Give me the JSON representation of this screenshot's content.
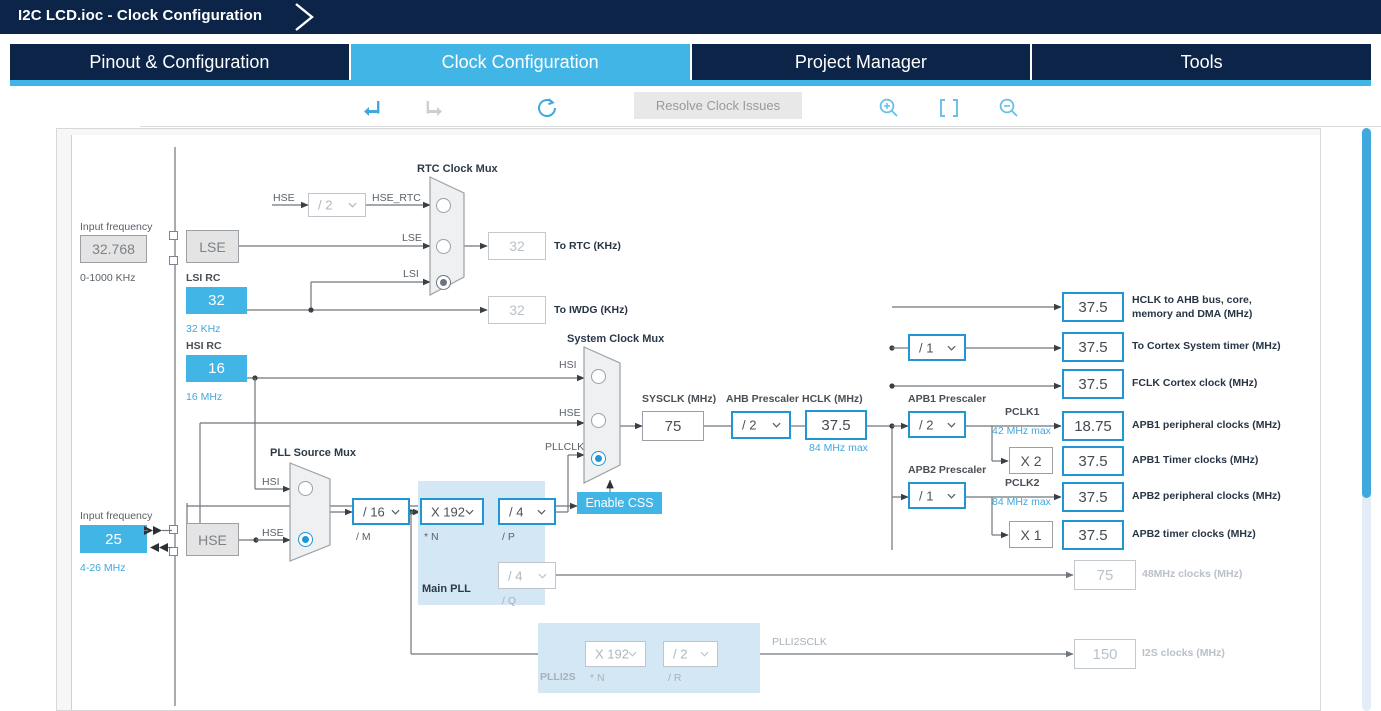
{
  "window": {
    "title": "I2C LCD.ioc - Clock Configuration"
  },
  "tabs": [
    {
      "label": "Pinout & Configuration",
      "active": false
    },
    {
      "label": "Clock Configuration",
      "active": true
    },
    {
      "label": "Project Manager",
      "active": false
    },
    {
      "label": "Tools",
      "active": false
    }
  ],
  "toolbar": {
    "undo": "undo-icon",
    "redo": "redo-icon",
    "reset": "reset-icon",
    "resolve_label": "Resolve Clock Issues",
    "zoom_in": "zoom-in-icon",
    "fit": "fit-to-screen-icon",
    "zoom_out": "zoom-out-icon"
  },
  "diagram": {
    "lse": {
      "input_frequency_label": "Input frequency",
      "input_frequency_value": "32.768",
      "range": "0-1000 KHz",
      "osc_label": "LSE"
    },
    "lsi": {
      "title": "LSI RC",
      "value": "32",
      "range": "32 KHz"
    },
    "hsi": {
      "title": "HSI RC",
      "value": "16",
      "range": "16 MHz"
    },
    "hse": {
      "input_frequency_label": "Input frequency",
      "input_frequency_value": "25",
      "range": "4-26 MHz",
      "osc_label": "HSE"
    },
    "hse_rtc_divider": {
      "value": "/ 2",
      "in_label": "HSE",
      "out_label": "HSE_RTC"
    },
    "rtc_mux": {
      "title": "RTC Clock Mux",
      "inputs": [
        "HSE_RTC",
        "LSE",
        "LSI"
      ],
      "selected_index": 2
    },
    "to_rtc": {
      "value": "32",
      "label": "To RTC (KHz)"
    },
    "to_iwdg": {
      "value": "32",
      "label": "To IWDG (KHz)"
    },
    "pll_source_mux": {
      "title": "PLL Source Mux",
      "inputs": [
        "HSI",
        "HSE"
      ],
      "selected_index": 1
    },
    "pll_m": {
      "value": "/ 16",
      "label": "/ M"
    },
    "main_pll": {
      "title": "Main PLL",
      "n": {
        "value": "X 192",
        "label": "* N"
      },
      "p": {
        "value": "/ 4",
        "label": "/ P"
      },
      "q": {
        "value": "/ 4",
        "label": "/ Q"
      }
    },
    "system_clock_mux": {
      "title": "System Clock Mux",
      "inputs": [
        "HSI",
        "HSE",
        "PLLCLK"
      ],
      "selected_index": 2
    },
    "enable_css": {
      "label": "Enable CSS"
    },
    "sysclk": {
      "title": "SYSCLK (MHz)",
      "value": "75"
    },
    "ahb_prescaler": {
      "title": "AHB Prescaler",
      "value": "/ 2"
    },
    "hclk": {
      "title": "HCLK (MHz)",
      "value": "37.5",
      "max": "84 MHz max"
    },
    "cortex_divider": {
      "value": "/ 1"
    },
    "outputs": [
      {
        "value": "37.5",
        "label": "HCLK to AHB bus, core,",
        "label2": "memory and DMA (MHz)"
      },
      {
        "value": "37.5",
        "label": "To Cortex System timer (MHz)"
      },
      {
        "value": "37.5",
        "label": "FCLK Cortex clock (MHz)"
      }
    ],
    "apb1": {
      "prescaler_title": "APB1 Prescaler",
      "prescaler_value": "/ 2",
      "pclk_label": "PCLK1",
      "pclk_max": "42 MHz max",
      "peripheral_value": "18.75",
      "peripheral_label": "APB1 peripheral clocks (MHz)",
      "timer_multiplier": "X 2",
      "timer_value": "37.5",
      "timer_label": "APB1 Timer clocks (MHz)"
    },
    "apb2": {
      "prescaler_title": "APB2 Prescaler",
      "prescaler_value": "/ 1",
      "pclk_label": "PCLK2",
      "pclk_max": "84 MHz max",
      "peripheral_value": "37.5",
      "peripheral_label": "APB2 peripheral clocks (MHz)",
      "timer_multiplier": "X 1",
      "timer_value": "37.5",
      "timer_label": "APB2 timer clocks (MHz)"
    },
    "clk48": {
      "value": "75",
      "label": "48MHz clocks (MHz)"
    },
    "plli2s": {
      "title": "PLLI2S",
      "n": {
        "value": "X 192",
        "label": "* N"
      },
      "r": {
        "value": "/ 2",
        "label": "/ R"
      },
      "out_label": "PLLI2SCLK",
      "i2s_value": "150",
      "i2s_label": "I2S clocks (MHz)"
    }
  },
  "colors": {
    "brand_dark": "#0b2447",
    "brand_accent": "#41b6e6",
    "active_border": "#2196d3",
    "pll_region": "#d4e7f5",
    "wire": "#6f767d"
  }
}
